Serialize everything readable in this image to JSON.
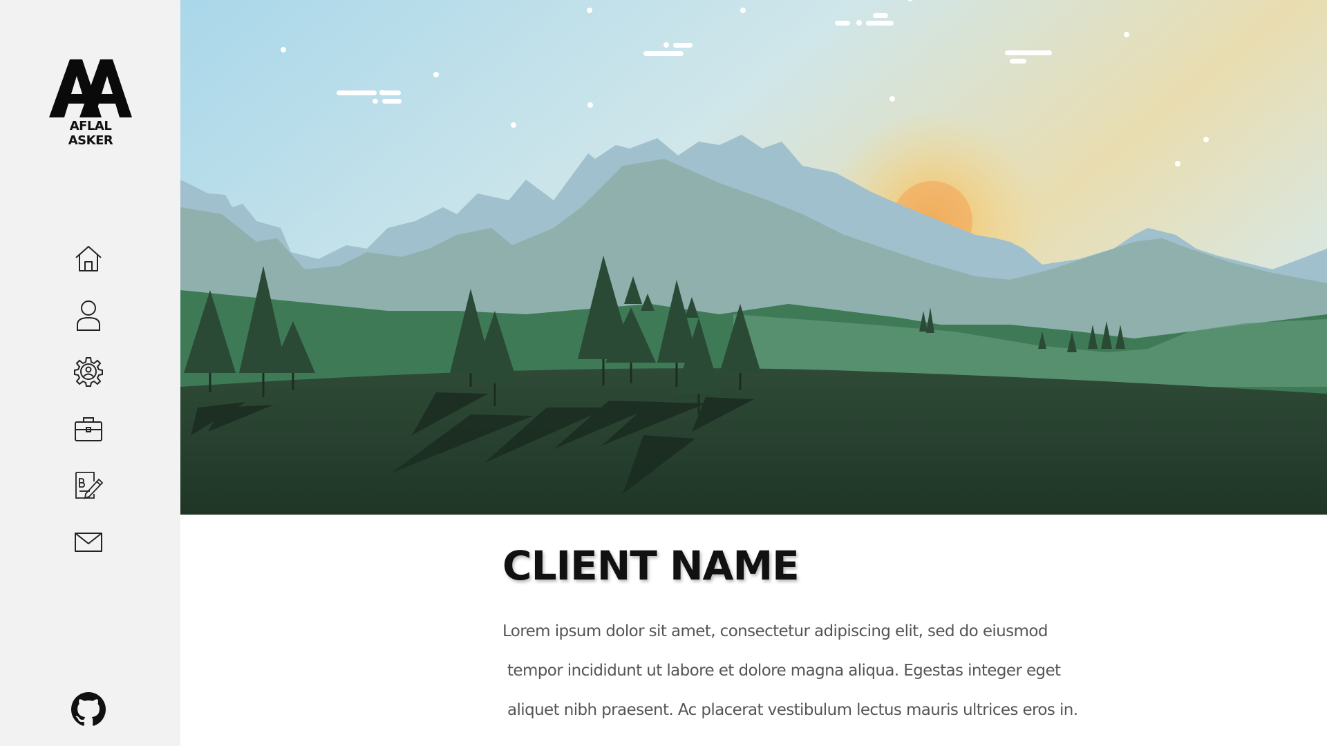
{
  "sidebar": {
    "logo_mark": "AA",
    "logo_name": "AFLAL ASKER",
    "nav": [
      {
        "icon": "home-icon"
      },
      {
        "icon": "user-icon"
      },
      {
        "icon": "gear-icon"
      },
      {
        "icon": "briefcase-icon"
      },
      {
        "icon": "edit-document-icon"
      },
      {
        "icon": "mail-icon"
      }
    ],
    "footer_icon": "github-icon"
  },
  "hero": {
    "image": "mountain-landscape-illustration"
  },
  "main": {
    "title": "CLIENT NAME",
    "paragraph_lines": [
      "Lorem ipsum dolor sit amet, consectetur adipiscing elit, sed do eiusmod",
      "tempor incididunt ut labore et dolore magna aliqua. Egestas integer eget",
      "aliquet nibh praesent. Ac placerat vestibulum lectus mauris ultrices eros in."
    ]
  }
}
